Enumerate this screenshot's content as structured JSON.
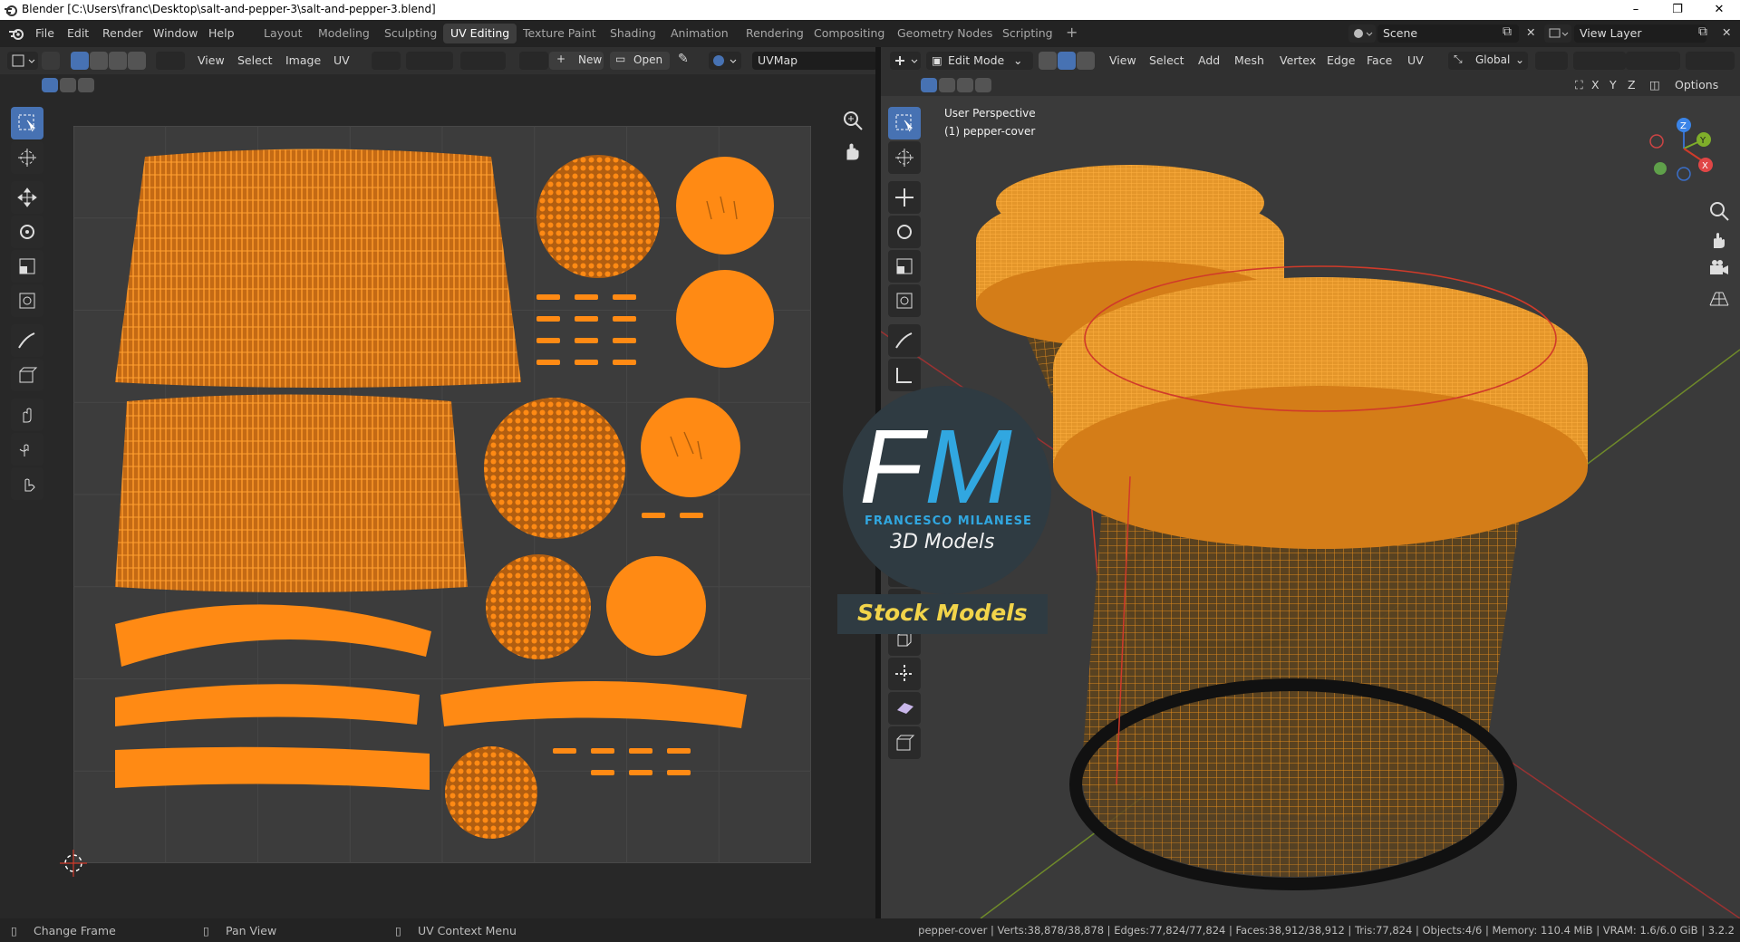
{
  "window": {
    "title": "Blender [C:\\Users\\franc\\Desktop\\salt-and-pepper-3\\salt-and-pepper-3.blend]"
  },
  "menus": [
    "File",
    "Edit",
    "Render",
    "Window",
    "Help"
  ],
  "workspaces": [
    "Layout",
    "Modeling",
    "Sculpting",
    "UV Editing",
    "Texture Paint",
    "Shading",
    "Animation",
    "Rendering",
    "Compositing",
    "Geometry Nodes",
    "Scripting"
  ],
  "active_workspace": "UV Editing",
  "scene": {
    "label": "Scene"
  },
  "view_layer": {
    "label": "View Layer"
  },
  "uv_header": {
    "view": "View",
    "select": "Select",
    "image": "Image",
    "uv": "UV",
    "new": "New",
    "open": "Open",
    "uvmap": "UVMap"
  },
  "vp_header": {
    "mode": "Edit Mode",
    "view": "View",
    "select": "Select",
    "add": "Add",
    "mesh": "Mesh",
    "vertex": "Vertex",
    "edge": "Edge",
    "face": "Face",
    "uv": "UV",
    "orientation": "Global",
    "options": "Options"
  },
  "viewport": {
    "perspective": "User Perspective",
    "object": "(1) pepper-cover"
  },
  "axes": {
    "x": "X",
    "y": "Y",
    "z": "Z"
  },
  "watermark": {
    "f": "F",
    "m": "M",
    "name": "FRANCESCO MILANESE",
    "models": "3D Models",
    "stock": "Stock Models"
  },
  "status": {
    "left": [
      "Change Frame",
      "Pan View",
      "UV Context Menu"
    ],
    "stats": "pepper-cover | Verts:38,878/38,878 | Edges:77,824/77,824 | Faces:38,912/38,912 | Tris:77,824 | Objects:4/6 | Memory: 110.4 MiB | VRAM: 1.6/6.0 GiB | 3.2.2"
  },
  "colors": {
    "uv_orange": "#ff8a14",
    "accent_blue": "#4772b3",
    "edge_red": "#d03a2a"
  }
}
